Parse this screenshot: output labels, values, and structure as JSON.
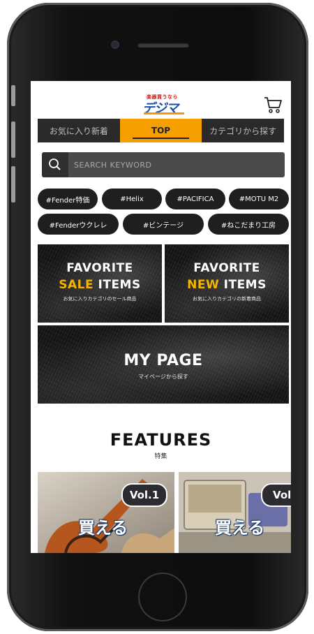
{
  "header": {
    "logo_top": "楽器買うなら",
    "logo_main": "デジマート"
  },
  "tabs": [
    {
      "label": "お気に入り新着",
      "active": false
    },
    {
      "label": "TOP",
      "active": true
    },
    {
      "label": "カテゴリから探す",
      "active": false
    }
  ],
  "search": {
    "placeholder": "SEARCH KEYWORD"
  },
  "tags": [
    "#Fender特価",
    "#Helix",
    "#PACIFICA",
    "#MOTU M2",
    "#Fenderウクレレ",
    "#ビンテージ",
    "#ねこだまり工房"
  ],
  "banners": {
    "sale": {
      "line1": "FAVORITE",
      "accent": "SALE",
      "rest": " ITEMS",
      "sub": "お気に入りカテゴリのセール商品"
    },
    "new": {
      "line1": "FAVORITE",
      "accent": "NEW",
      "rest": " ITEMS",
      "sub": "お気に入りカテゴリの新着商品"
    },
    "mypage": {
      "title": "MY PAGE",
      "sub": "マイページから探す"
    }
  },
  "features": {
    "title": "FEATURES",
    "subtitle": "特集",
    "cards": [
      {
        "vol": "Vol.1",
        "text": "買える"
      },
      {
        "vol": "Vol.",
        "text": "買える"
      }
    ]
  },
  "colors": {
    "accent": "#f5a000",
    "tab_bg": "#2a2a2a",
    "logo_blue": "#1b4fa8"
  },
  "icons": {
    "cart": "cart-icon",
    "search": "search-icon"
  }
}
